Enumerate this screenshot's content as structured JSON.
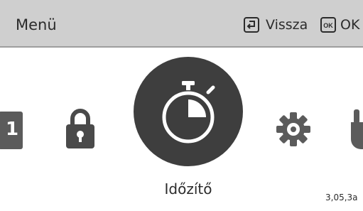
{
  "header": {
    "title": "Menü",
    "back_label": "Vissza",
    "ok_label": "OK",
    "ok_icon_text": "OK"
  },
  "carousel": {
    "left_partial_text": "1",
    "selected_label": "Időzítő",
    "right_partial_label": "3,05,3a"
  }
}
